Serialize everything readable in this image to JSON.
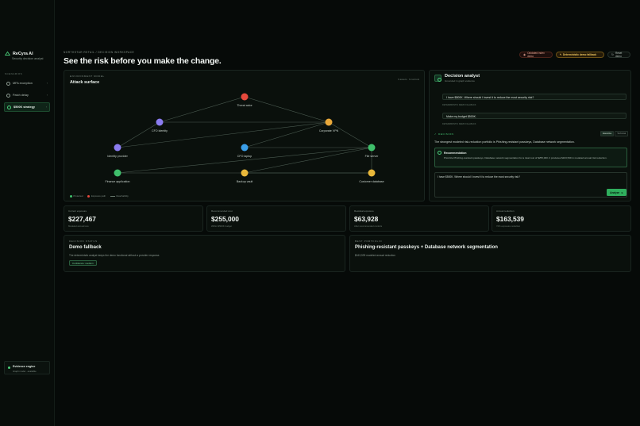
{
  "sidebar": {
    "brand_name": "ReCyra AI",
    "brand_sub": "Security decision analyst",
    "section_label": "SCENARIOS",
    "items": [
      {
        "label": "MFA exception",
        "active": false
      },
      {
        "label": "Patch delay",
        "active": false
      },
      {
        "label": "$500K strategy",
        "active": true
      }
    ],
    "evidence": {
      "title": "Evidence engine",
      "subtitle": "Graph model · available"
    }
  },
  "header": {
    "breadcrumb": "NORTHSTAR RETAIL / DECISION WORKSPACE",
    "title": "See the risk before you make the change.",
    "buttons": {
      "outdated": "Outdated index demo",
      "fallback": "Deterministic demo fallback",
      "reset": "Reset demo"
    }
  },
  "attack": {
    "env_label": "ENVIRONMENT MODEL",
    "title": "Attack surface",
    "meta": "9 assets · 9 controls",
    "nodes": [
      {
        "label": "Threat actor",
        "color": "#e5493c"
      },
      {
        "label": "CFO identity",
        "color": "#8b7cf0"
      },
      {
        "label": "Corporate VPN",
        "color": "#e9a83a"
      },
      {
        "label": "Identity provider",
        "color": "#8b7cf0"
      },
      {
        "label": "CFO laptop",
        "color": "#3a9ee9"
      },
      {
        "label": "File server",
        "color": "#3fbf6b"
      },
      {
        "label": "Finance application",
        "color": "#3fbf6b"
      },
      {
        "label": "Backup vault",
        "color": "#e9b83a"
      },
      {
        "label": "Customer database",
        "color": "#e9b83a"
      }
    ],
    "legend": {
      "a": "Protected",
      "b": "Exposure path",
      "c": "Reachability"
    }
  },
  "analyst": {
    "title": "Decision analyst",
    "subtitle": "Grounded in graph evidence",
    "messages": [
      {
        "text": "I have $500K. Where should I invest it to reduce the most security risk?",
        "meta": "DETERMINISTIC DEMO FALLBACK"
      },
      {
        "text": "Make my budget $500K.",
        "meta": "DETERMINISTIC DEMO FALLBACK"
      }
    ],
    "decision_label": "DECISION",
    "tabs": [
      "Executive",
      "Technical"
    ],
    "decision_text": "The strongest modeled risk-reduction portfolio is Phishing-resistant passkeys, Database network segmentation.",
    "recommendation_title": "Recommendation",
    "recommendation_text": "Prioritize Phishing-resistant passkeys, Database network segmentation for a total cost of $255,000. It produces $163,539 in modeled annual risk reduction.",
    "input_value": "I have $500K. Where should I invest it to reduce the most security risk?",
    "analyze_label": "Analyze"
  },
  "metrics": [
    {
      "label": "Current exposure",
      "value": "$227,467",
      "sub": "Modeled annual loss"
    },
    {
      "label": "Recommended cost",
      "value": "$255,000",
      "sub": "Within $500K budget"
    },
    {
      "label": "Residual exposure",
      "value": "$63,928",
      "sub": "After recommended controls"
    },
    {
      "label": "Annual reduction",
      "value": "$163,539",
      "sub": "72% exposure reduction"
    }
  ],
  "decision_status": {
    "label": "DECISION STATUS",
    "title": "Demo fallback",
    "text": "The deterministic analyst keeps the demo functional without a provider response.",
    "badge": "Confidence: medium"
  },
  "portfolio": {
    "label": "BEST PORTFOLIO",
    "title": "Phishing-resistant passkeys + Database network segmentation",
    "text": "$163,539 modeled annual reduction"
  }
}
